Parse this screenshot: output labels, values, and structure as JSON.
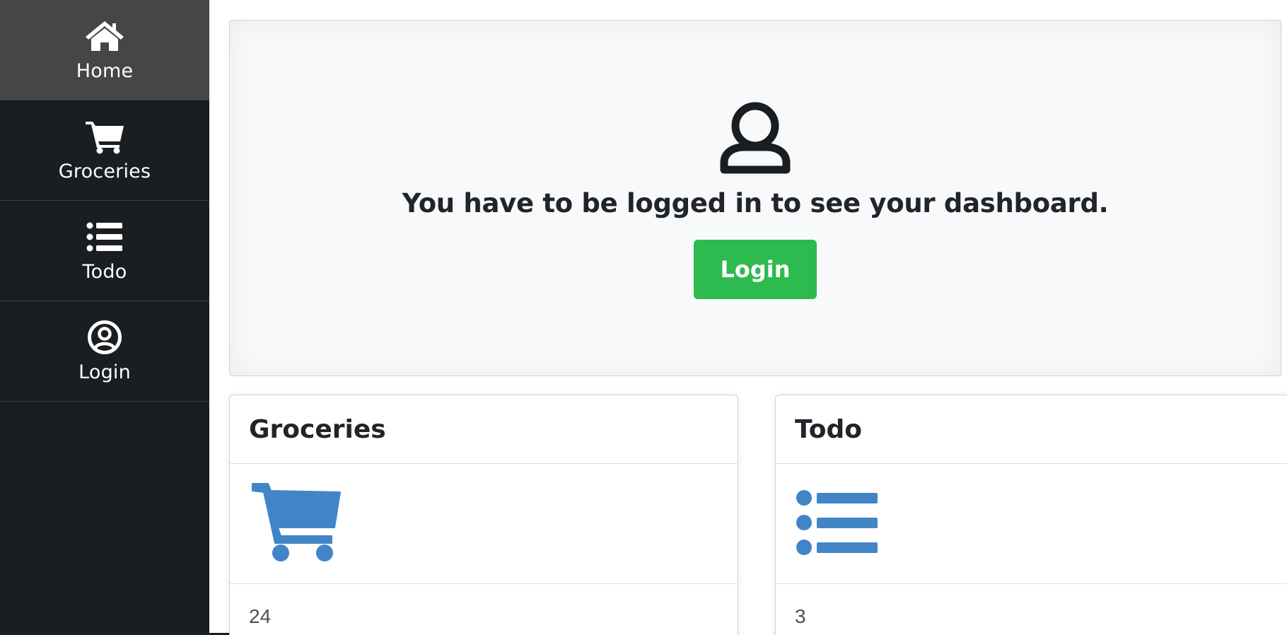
{
  "sidebar": {
    "items": [
      {
        "label": "Home",
        "icon": "home-icon",
        "active": true
      },
      {
        "label": "Groceries",
        "icon": "cart-icon",
        "active": false
      },
      {
        "label": "Todo",
        "icon": "list-icon",
        "active": false
      },
      {
        "label": "Login",
        "icon": "user-circle-icon",
        "active": false
      }
    ]
  },
  "hero": {
    "icon": "user-icon",
    "message": "You have to be logged in to see your dashboard.",
    "login_label": "Login"
  },
  "cards": {
    "groceries": {
      "title": "Groceries",
      "icon": "cart-icon",
      "count": "24"
    },
    "todo": {
      "title": "Todo",
      "icon": "list-icon",
      "count": "3"
    }
  },
  "colors": {
    "sidebar_bg": "#1b1e21",
    "sidebar_active_bg": "#444647",
    "success": "#2dba4e",
    "accent_icon": "#4285c6"
  }
}
